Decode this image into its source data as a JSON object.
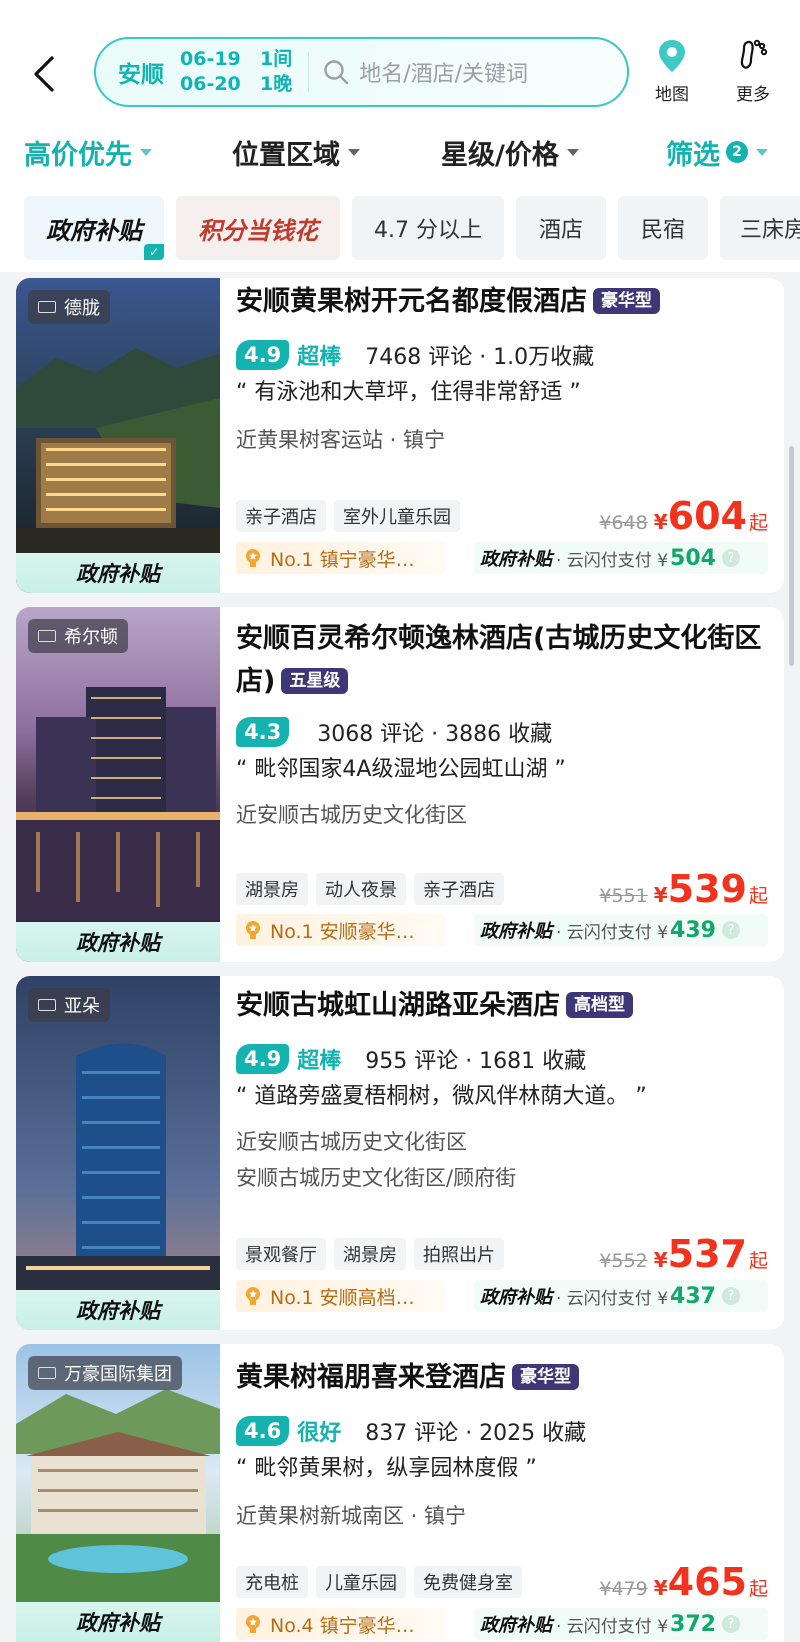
{
  "search": {
    "city": "安顺",
    "checkin": "06-19",
    "checkout": "06-20",
    "rooms": "1间",
    "nights": "1晚",
    "placeholder": "地名/酒店/关键词"
  },
  "header_actions": {
    "map_label": "地图",
    "more_label": "更多"
  },
  "sort": {
    "price_sort": "高价优先",
    "location": "位置区域",
    "star_price": "星级/价格",
    "filter": "筛选",
    "filter_count": "2"
  },
  "quick_tags": [
    "政府补贴",
    "积分当钱花",
    "4.7 分以上",
    "酒店",
    "民宿",
    "三床房"
  ],
  "colors": {
    "accent": "#14b3b0",
    "price": "#f1321d",
    "level_badge": "#3e3677",
    "subsidy_green": "#12a86a"
  },
  "hotels": [
    {
      "brand": "德胧",
      "name": "安顺黄果树开元名都度假酒店",
      "level": "豪华型",
      "score": "4.9",
      "score_word": "超棒",
      "reviews": "7468 评论 · 1.0万收藏",
      "quote": "“ 有泳池和大草坪，住得非常舒适 ”",
      "locations": [
        "近黄果树客运站 · 镇宁"
      ],
      "features": [
        "亲子酒店",
        "室外儿童乐园"
      ],
      "orig_price": "¥648",
      "yen": "¥",
      "price": "604",
      "qi": "起",
      "rank": "No.1 镇宁豪华…",
      "subsidy_label": "政府补贴",
      "subsidy_text": "· 云闪付支付 ¥",
      "subsidy_amount": "504",
      "thumb_label": "政府补贴"
    },
    {
      "brand": "希尔顿",
      "name": "安顺百灵希尔顿逸林酒店(古城历史文化街区店)",
      "level": "五星级",
      "score": "4.3",
      "score_word": "",
      "reviews": "3068 评论 · 3886 收藏",
      "quote": "“ 毗邻国家4A级湿地公园虹山湖 ”",
      "locations": [
        "近安顺古城历史文化街区"
      ],
      "features": [
        "湖景房",
        "动人夜景",
        "亲子酒店"
      ],
      "orig_price": "¥551",
      "yen": "¥",
      "price": "539",
      "qi": "起",
      "rank": "No.1 安顺豪华…",
      "subsidy_label": "政府补贴",
      "subsidy_text": "· 云闪付支付 ¥",
      "subsidy_amount": "439",
      "thumb_label": "政府补贴"
    },
    {
      "brand": "亚朵",
      "name": "安顺古城虹山湖路亚朵酒店",
      "level": "高档型",
      "score": "4.9",
      "score_word": "超棒",
      "reviews": "955 评论 · 1681 收藏",
      "quote": "“ 道路旁盛夏梧桐树，微风伴林荫大道。 ”",
      "locations": [
        "近安顺古城历史文化街区",
        "安顺古城历史文化街区/顾府街"
      ],
      "features": [
        "景观餐厅",
        "湖景房",
        "拍照出片"
      ],
      "orig_price": "¥552",
      "yen": "¥",
      "price": "537",
      "qi": "起",
      "rank": "No.1 安顺高档…",
      "subsidy_label": "政府补贴",
      "subsidy_text": "· 云闪付支付 ¥",
      "subsidy_amount": "437",
      "thumb_label": "政府补贴"
    },
    {
      "brand": "万豪国际集团",
      "name": "黄果树福朋喜来登酒店",
      "level": "豪华型",
      "score": "4.6",
      "score_word": "很好",
      "reviews": "837 评论 · 2025 收藏",
      "quote": "“ 毗邻黄果树，纵享园林度假 ”",
      "locations": [
        "近黄果树新城南区 · 镇宁"
      ],
      "features": [
        "充电桩",
        "儿童乐园",
        "免费健身室"
      ],
      "orig_price": "¥479",
      "yen": "¥",
      "price": "465",
      "qi": "起",
      "rank": "No.4 镇宁豪华…",
      "subsidy_label": "政府补贴",
      "subsidy_text": "· 云闪付支付 ¥",
      "subsidy_amount": "372",
      "thumb_label": "政府补贴"
    }
  ]
}
